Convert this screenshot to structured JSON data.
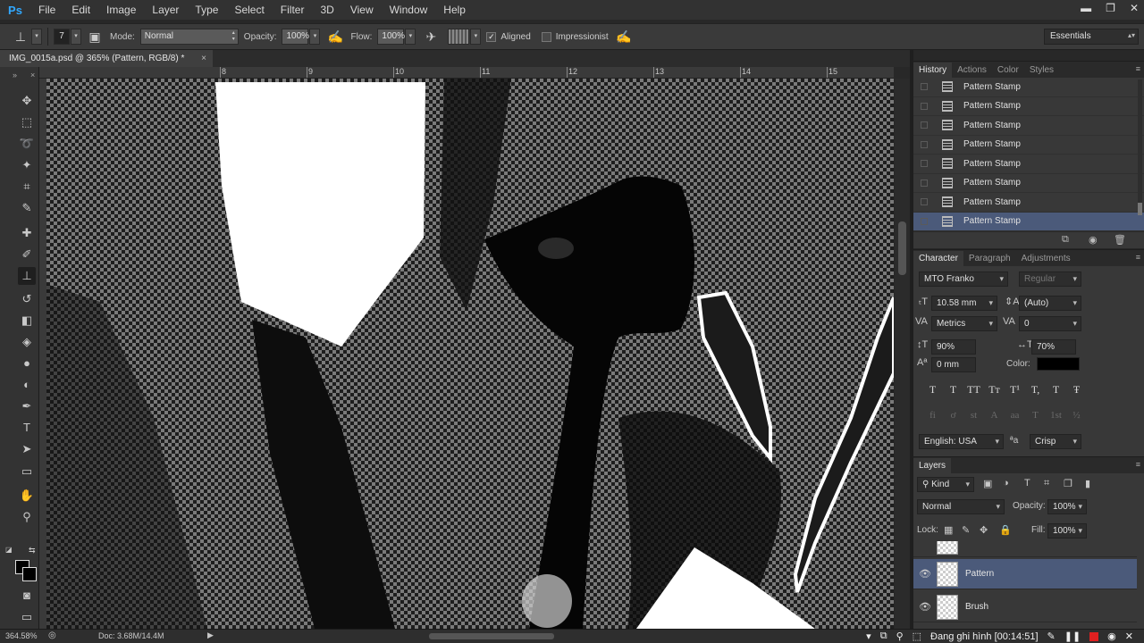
{
  "app": {
    "logo": "Ps"
  },
  "menu": [
    "File",
    "Edit",
    "Image",
    "Layer",
    "Type",
    "Select",
    "Filter",
    "3D",
    "View",
    "Window",
    "Help"
  ],
  "window_controls": {
    "minimize": "▬",
    "restore": "❐",
    "close": "✕"
  },
  "options": {
    "brush_size": "7",
    "mode_label": "Mode:",
    "mode_value": "Normal",
    "opacity_label": "Opacity:",
    "opacity_value": "100%",
    "flow_label": "Flow:",
    "flow_value": "100%",
    "aligned_label": "Aligned",
    "aligned_checked": true,
    "impressionist_label": "Impressionist",
    "impressionist_checked": false,
    "workspace": "Essentials"
  },
  "document": {
    "tab_title": "IMG_0015a.psd @ 365% (Pattern, RGB/8) *",
    "close": "×",
    "ruler_numbers": [
      "8",
      "9",
      "10",
      "11",
      "12",
      "13",
      "14",
      "15"
    ]
  },
  "tools": [
    {
      "name": "move-tool-icon",
      "glyph": "✥"
    },
    {
      "name": "marquee-tool-icon",
      "glyph": "⬚"
    },
    {
      "name": "lasso-tool-icon",
      "glyph": "➰"
    },
    {
      "name": "quick-select-tool-icon",
      "glyph": "✦"
    },
    {
      "name": "crop-tool-icon",
      "glyph": "⌗"
    },
    {
      "name": "eyedropper-tool-icon",
      "glyph": "✎"
    },
    {
      "name": "healing-tool-icon",
      "glyph": "✚"
    },
    {
      "name": "brush-tool-icon",
      "glyph": "✐"
    },
    {
      "name": "stamp-tool-icon",
      "glyph": "⊥"
    },
    {
      "name": "history-brush-tool-icon",
      "glyph": "↺"
    },
    {
      "name": "eraser-tool-icon",
      "glyph": "◧"
    },
    {
      "name": "paint-bucket-tool-icon",
      "glyph": "◈"
    },
    {
      "name": "blur-tool-icon",
      "glyph": "●"
    },
    {
      "name": "dodge-tool-icon",
      "glyph": "◐"
    },
    {
      "name": "pen-tool-icon",
      "glyph": "✒"
    },
    {
      "name": "type-tool-icon",
      "glyph": "T"
    },
    {
      "name": "path-select-tool-icon",
      "glyph": "➤"
    },
    {
      "name": "shape-tool-icon",
      "glyph": "▭"
    },
    {
      "name": "hand-tool-icon",
      "glyph": "✋"
    },
    {
      "name": "zoom-tool-icon",
      "glyph": "⚲"
    }
  ],
  "history_panel": {
    "tabs": [
      "History",
      "Actions",
      "Color",
      "Styles"
    ],
    "items": [
      "Pattern Stamp",
      "Pattern Stamp",
      "Pattern Stamp",
      "Pattern Stamp",
      "Pattern Stamp",
      "Pattern Stamp",
      "Pattern Stamp",
      "Pattern Stamp"
    ],
    "selected_index": 7
  },
  "character_panel": {
    "tabs": [
      "Character",
      "Paragraph",
      "Adjustments"
    ],
    "font_family": "MTO Franko",
    "font_style": "Regular",
    "font_size": "10.58 mm",
    "leading": "(Auto)",
    "kerning": "Metrics",
    "tracking": "0",
    "vertical_scale": "90%",
    "horizontal_scale": "70%",
    "baseline_shift": "0 mm",
    "color_label": "Color:",
    "color_value": "#000000",
    "typo_buttons": [
      "T",
      "T",
      "TT",
      "Tт",
      "T¹",
      "T,",
      "T",
      "Ŧ"
    ],
    "opentype_buttons": [
      "fi",
      "ơ",
      "st",
      "A",
      "aa",
      "T",
      "1st",
      "½"
    ],
    "language": "English: USA",
    "aa_label": "ªa",
    "antialias": "Crisp"
  },
  "layers_panel": {
    "title": "Layers",
    "filter_kind": "Kind",
    "blend_mode": "Normal",
    "opacity_label": "Opacity:",
    "opacity_value": "100%",
    "lock_label": "Lock:",
    "fill_label": "Fill:",
    "fill_value": "100%",
    "layers": [
      {
        "name": "Pattern",
        "visible": true,
        "selected": true
      },
      {
        "name": "Brush",
        "visible": true,
        "selected": false
      }
    ]
  },
  "status": {
    "zoom": "364.58%",
    "doc": "Doc: 3.68M/14.4M",
    "recording": "Đang ghi hình [00:14:51]"
  }
}
